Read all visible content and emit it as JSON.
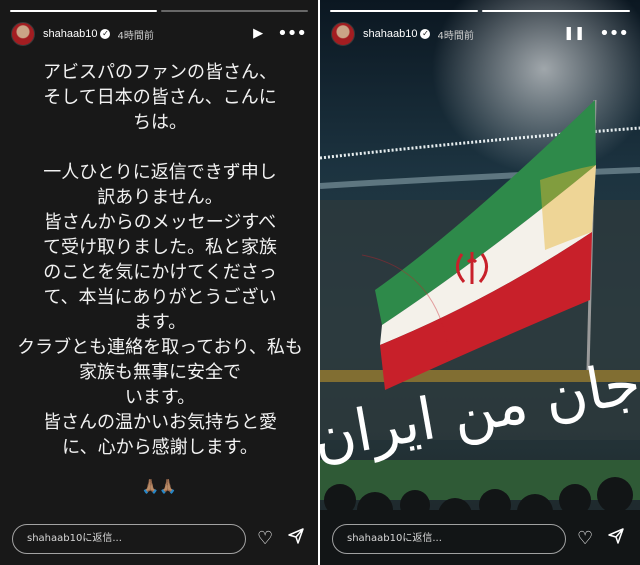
{
  "stories": [
    {
      "progress": {
        "segments": 2,
        "completed": 1
      },
      "user": {
        "username": "shahaab10",
        "time": "4時間前",
        "verified": true
      },
      "play_icon": "play-icon",
      "more_icon": "more-icon",
      "message": "アビスパのファンの皆さん、\nそして日本の皆さん、こんに\nちは。\n\n一人ひとりに返信できず申し\n訳ありません。\n皆さんからのメッセージすべ\nて受け取りました。私と家族\nのことを気にかけてくださっ\nて、本当にありがとうござい\nます。\nクラブとも連絡を取っており、私も家族も無事に安全で\nいます。\n皆さんの温かいお気持ちと愛\nに、心から感謝します。",
      "emoji": "🙏🏽🙏🏽",
      "reply_placeholder": "shahaab10に返信...",
      "like_icon": "heart-icon",
      "share_icon": "send-icon"
    },
    {
      "progress": {
        "segments": 2,
        "completed": 2
      },
      "user": {
        "username": "shahaab10",
        "time": "4時間前",
        "verified": true
      },
      "pause_icon": "pause-icon",
      "more_icon": "more-icon",
      "image_text": "جان من ایران",
      "reply_placeholder": "shahaab10に返信...",
      "like_icon": "heart-icon",
      "share_icon": "send-icon",
      "colors": {
        "green": "#2e8a4a",
        "white": "#f4f1ea",
        "red": "#c8202a",
        "stadium": "#0c1a24"
      }
    }
  ]
}
